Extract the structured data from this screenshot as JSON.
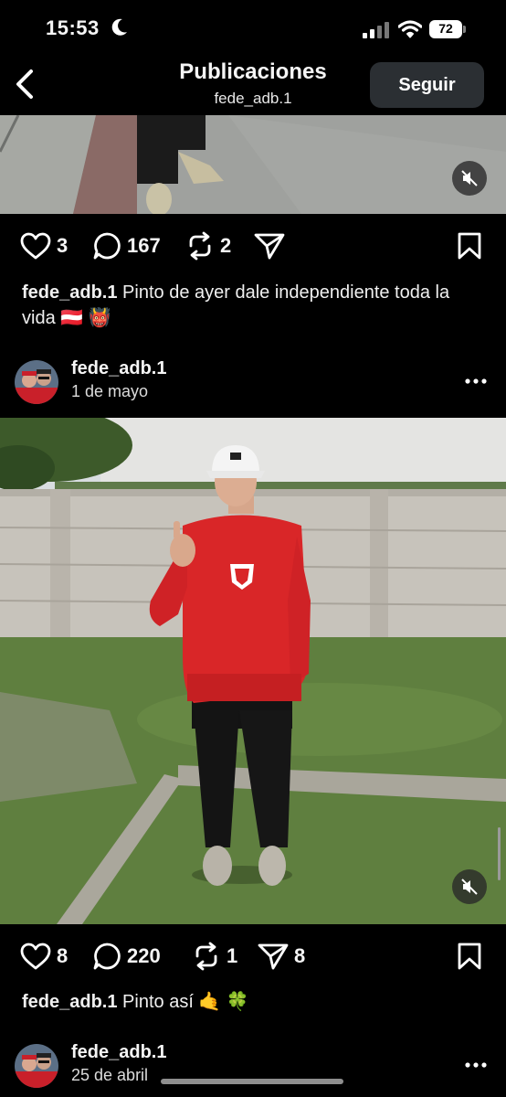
{
  "status_bar": {
    "time": "15:53",
    "battery": "72"
  },
  "header": {
    "title": "Publicaciones",
    "subtitle": "fede_adb.1",
    "follow_label": "Seguir"
  },
  "posts": [
    {
      "likes": "3",
      "comments": "167",
      "reposts": "2",
      "shares": "",
      "caption_user": "fede_adb.1",
      "caption_text": "Pinto de ayer dale independiente toda la vida 🇦🇹 👹"
    },
    {
      "username": "fede_adb.1",
      "date": "1 de mayo",
      "likes": "8",
      "comments": "220",
      "reposts": "1",
      "shares": "8",
      "caption_user": "fede_adb.1",
      "caption_text": "Pinto así 🤙 🍀"
    },
    {
      "username": "fede_adb.1",
      "date": "25 de abril"
    }
  ],
  "icons": [
    "moon-icon",
    "signal-icon",
    "wifi-icon",
    "back-icon",
    "muted-speaker-icon",
    "heart-icon",
    "comment-icon",
    "repost-icon",
    "send-icon",
    "bookmark-icon",
    "more-icon"
  ],
  "colors": {
    "background": "#000000",
    "follow_button": "#2b2f33",
    "hoodie": "#d92628"
  }
}
